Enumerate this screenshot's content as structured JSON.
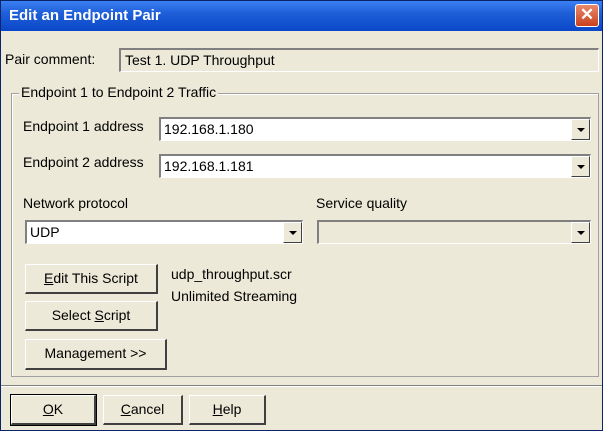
{
  "window": {
    "title": "Edit an Endpoint Pair",
    "close_glyph": "✕"
  },
  "pair_comment": {
    "label": "Pair comment:",
    "value": "Test 1. UDP Throughput"
  },
  "traffic_group": {
    "title": "Endpoint 1 to Endpoint 2 Traffic",
    "endpoint1": {
      "label": "Endpoint 1 address",
      "value": "192.168.1.180"
    },
    "endpoint2": {
      "label": "Endpoint 2 address",
      "value": "192.168.1.181"
    },
    "network_protocol": {
      "label": "Network protocol",
      "value": "UDP"
    },
    "service_quality": {
      "label": "Service quality",
      "value": ""
    }
  },
  "buttons": {
    "edit_script": {
      "mnemonic": "E",
      "rest": "dit This Script"
    },
    "select_script": {
      "pre": "Select ",
      "mnemonic": "S",
      "rest": "cript"
    },
    "management": "Management >>"
  },
  "script_info": {
    "filename": "udp_throughput.scr",
    "description": "Unlimited Streaming"
  },
  "footer": {
    "ok": {
      "mnemonic": "O",
      "rest": "K"
    },
    "cancel": {
      "mnemonic": "C",
      "rest": "ancel"
    },
    "help": {
      "mnemonic": "H",
      "rest": "elp"
    }
  }
}
